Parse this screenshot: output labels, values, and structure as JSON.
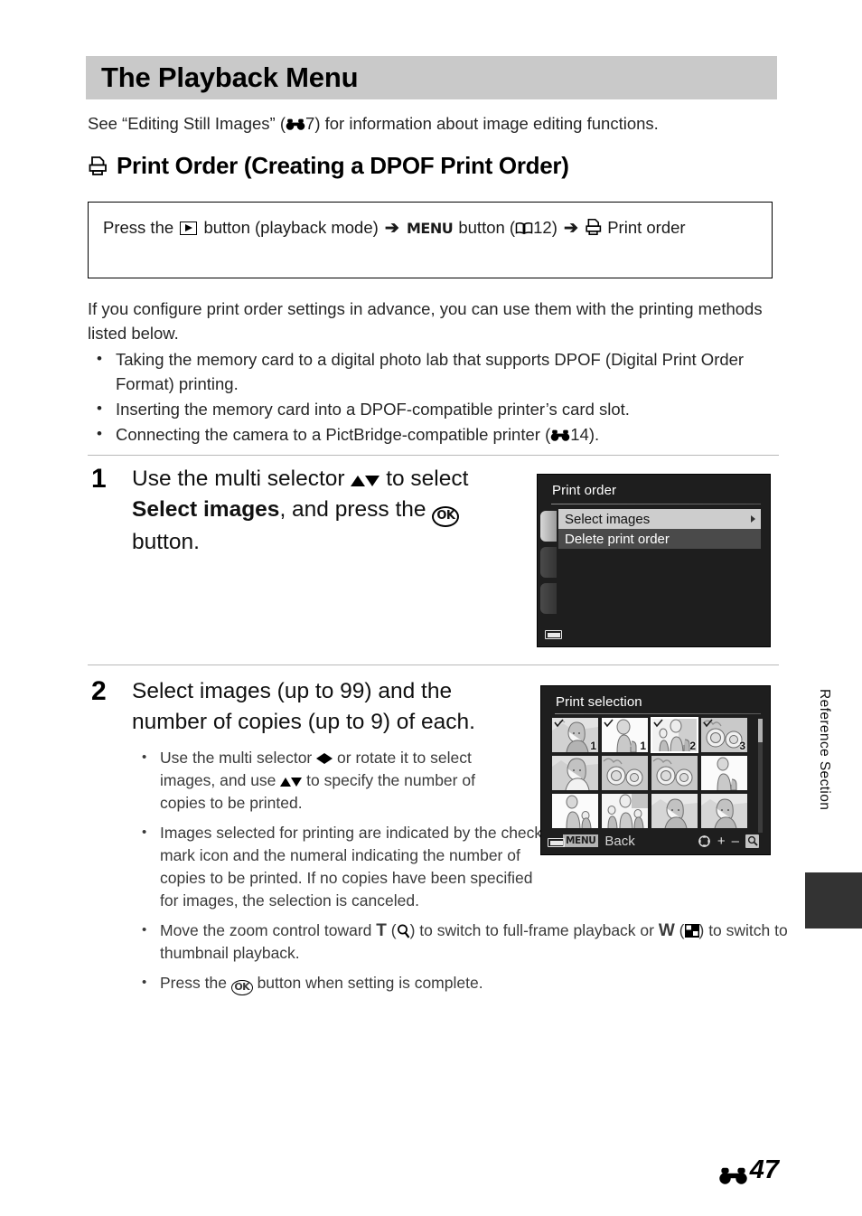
{
  "page": {
    "title": "The Playback Menu",
    "intro_before": "See “Editing Still Images” (",
    "intro_ref_num": "7",
    "intro_after": ") for information about image editing functions.",
    "section_heading": "Print Order (Creating a DPOF Print Order)",
    "section_icon": "printer-icon",
    "page_number": "47",
    "page_number_prefix_icon": "reference-section-icon",
    "side_tab_label": "Reference Section"
  },
  "path_box": {
    "seg1": "Press the",
    "icon1": "playback-button-icon",
    "seg2": "button (playback mode)",
    "arrow1": "➔",
    "menu_label": "MENU",
    "seg3": "button (",
    "book_icon": "manual-book-icon",
    "book_ref": "12",
    "seg4": ")",
    "arrow2": "➔",
    "printer_icon": "printer-icon",
    "seg5": "Print order"
  },
  "intro_body": {
    "paragraph": "If you configure print order settings in advance, you can use them with the printing methods listed below.",
    "bullets": [
      {
        "text": "Taking the memory card to a digital photo lab that supports DPOF (Digital Print Order Format) printing."
      },
      {
        "text": "Inserting the memory card into a DPOF-compatible printer’s card slot."
      },
      {
        "text_before": "Connecting the camera to a PictBridge-compatible printer (",
        "ref_icon": "reference-section-icon",
        "ref_num": "14",
        "text_after": ")."
      }
    ]
  },
  "steps": [
    {
      "number": "1",
      "head_a": "Use the multi selector",
      "head_icons": "up-down-triangle-icons",
      "head_b": "to select",
      "head_bold": "Select images",
      "head_c": ", and press the",
      "head_ok": "ok-button-icon",
      "head_d": "button."
    },
    {
      "number": "2",
      "head": "Select images (up to 99) and the number of copies (up to 9) of each.",
      "bullets": [
        {
          "a": "Use the multi selector",
          "icon1": "left-right-triangle-icons",
          "b": "or rotate it to select images, and use",
          "icon2": "up-down-triangle-icons",
          "c": "to specify the number of copies to be printed."
        },
        {
          "a": "Images selected for printing are indicated by the check mark icon and the numeral indicating the number of copies to be printed. If no copies have been specified for images, the selection is canceled."
        },
        {
          "a": "Move the zoom control toward",
          "t_letter": "T",
          "b": "(",
          "icon1": "magnify-icon",
          "c": ") to switch to full-frame playback or",
          "w_letter": "W",
          "d": "(",
          "icon2": "thumbnail-grid-icon",
          "e": ") to switch to thumbnail playback."
        },
        {
          "a": "Press the",
          "icon1": "ok-button-icon",
          "b": "button when setting is complete."
        }
      ]
    }
  ],
  "lcd_print_order": {
    "title": "Print order",
    "menu_items": [
      {
        "label": "Select images",
        "selected": true,
        "has_submenu": true
      },
      {
        "label": "Delete print order",
        "selected": false,
        "has_submenu": false
      }
    ],
    "battery_icon": "battery-full-icon",
    "tabs": [
      {
        "name": "tab-active",
        "active": true
      },
      {
        "name": "tab-2",
        "active": false
      },
      {
        "name": "tab-3",
        "active": false
      }
    ]
  },
  "lcd_print_selection": {
    "title": "Print selection",
    "menu_key_label": "MENU",
    "back_label": "Back",
    "footer_icons": [
      "rotary-multi-selector-icon",
      "plus-icon",
      "minus-icon",
      "magnify-icon"
    ],
    "battery_icon": "battery-full-icon",
    "thumbnails": [
      {
        "index": 1,
        "scene": "portrait-woman",
        "checked": true,
        "copies": "1",
        "current": false
      },
      {
        "index": 2,
        "scene": "woman-child",
        "checked": true,
        "copies": "1",
        "current": false
      },
      {
        "index": 3,
        "scene": "woman-two-kids",
        "checked": true,
        "copies": "2",
        "current": true
      },
      {
        "index": 4,
        "scene": "flowers",
        "checked": true,
        "copies": "3",
        "current": false
      },
      {
        "index": 5,
        "scene": "portrait-woman",
        "checked": false,
        "copies": "",
        "current": false
      },
      {
        "index": 6,
        "scene": "flowers",
        "checked": false,
        "copies": "",
        "current": false
      },
      {
        "index": 7,
        "scene": "flowers",
        "checked": false,
        "copies": "",
        "current": false
      },
      {
        "index": 8,
        "scene": "woman-child",
        "checked": false,
        "copies": "",
        "current": false
      },
      {
        "index": 9,
        "scene": "woman-child",
        "checked": false,
        "copies": "",
        "current": false
      },
      {
        "index": 10,
        "scene": "woman-two-kids",
        "checked": false,
        "copies": "",
        "current": false
      },
      {
        "index": 11,
        "scene": "portrait-woman",
        "checked": false,
        "copies": "",
        "current": false
      },
      {
        "index": 12,
        "scene": "portrait-woman",
        "checked": false,
        "copies": "",
        "current": false
      }
    ]
  },
  "colors": {
    "title_band": "#c9c9c9",
    "lcd_background": "#1e1e1e",
    "menu_selected_bg": "#cdcdcd",
    "menu_normal_bg": "#4a4a4a",
    "side_tab": "#333333"
  }
}
